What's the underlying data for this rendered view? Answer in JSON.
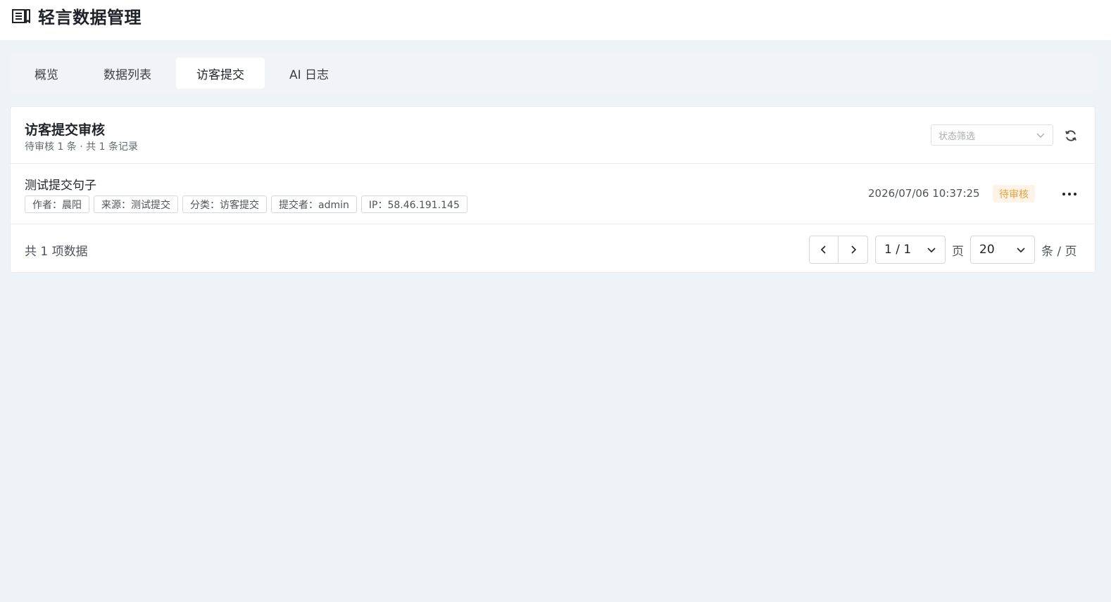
{
  "app": {
    "title": "轻言数据管理",
    "logo_icon": "book-list-icon"
  },
  "tabs": [
    {
      "label": "概览",
      "active": false
    },
    {
      "label": "数据列表",
      "active": false
    },
    {
      "label": "访客提交",
      "active": true
    },
    {
      "label": "AI 日志",
      "active": false
    }
  ],
  "review": {
    "title": "访客提交审核",
    "subtitle": "待审核 1 条 · 共 1 条记录",
    "filter_placeholder": "状态筛选",
    "refresh_icon": "refresh-icon"
  },
  "submissions": [
    {
      "title": "测试提交句子",
      "tags": [
        "作者：晨阳",
        "来源：测试提交",
        "分类：访客提交",
        "提交者：admin",
        "IP：58.46.191.145"
      ],
      "time": "2026/07/06 10:37:25",
      "status": "待审核"
    }
  ],
  "pagination": {
    "total_text": "共 1 项数据",
    "page_value": "1 / 1",
    "page_unit": "页",
    "page_size": "20",
    "size_unit": "条 / 页"
  },
  "colors": {
    "background": "#eef3f7",
    "pending_text": "#e6a23c",
    "pending_bg": "#fdf3e6"
  }
}
